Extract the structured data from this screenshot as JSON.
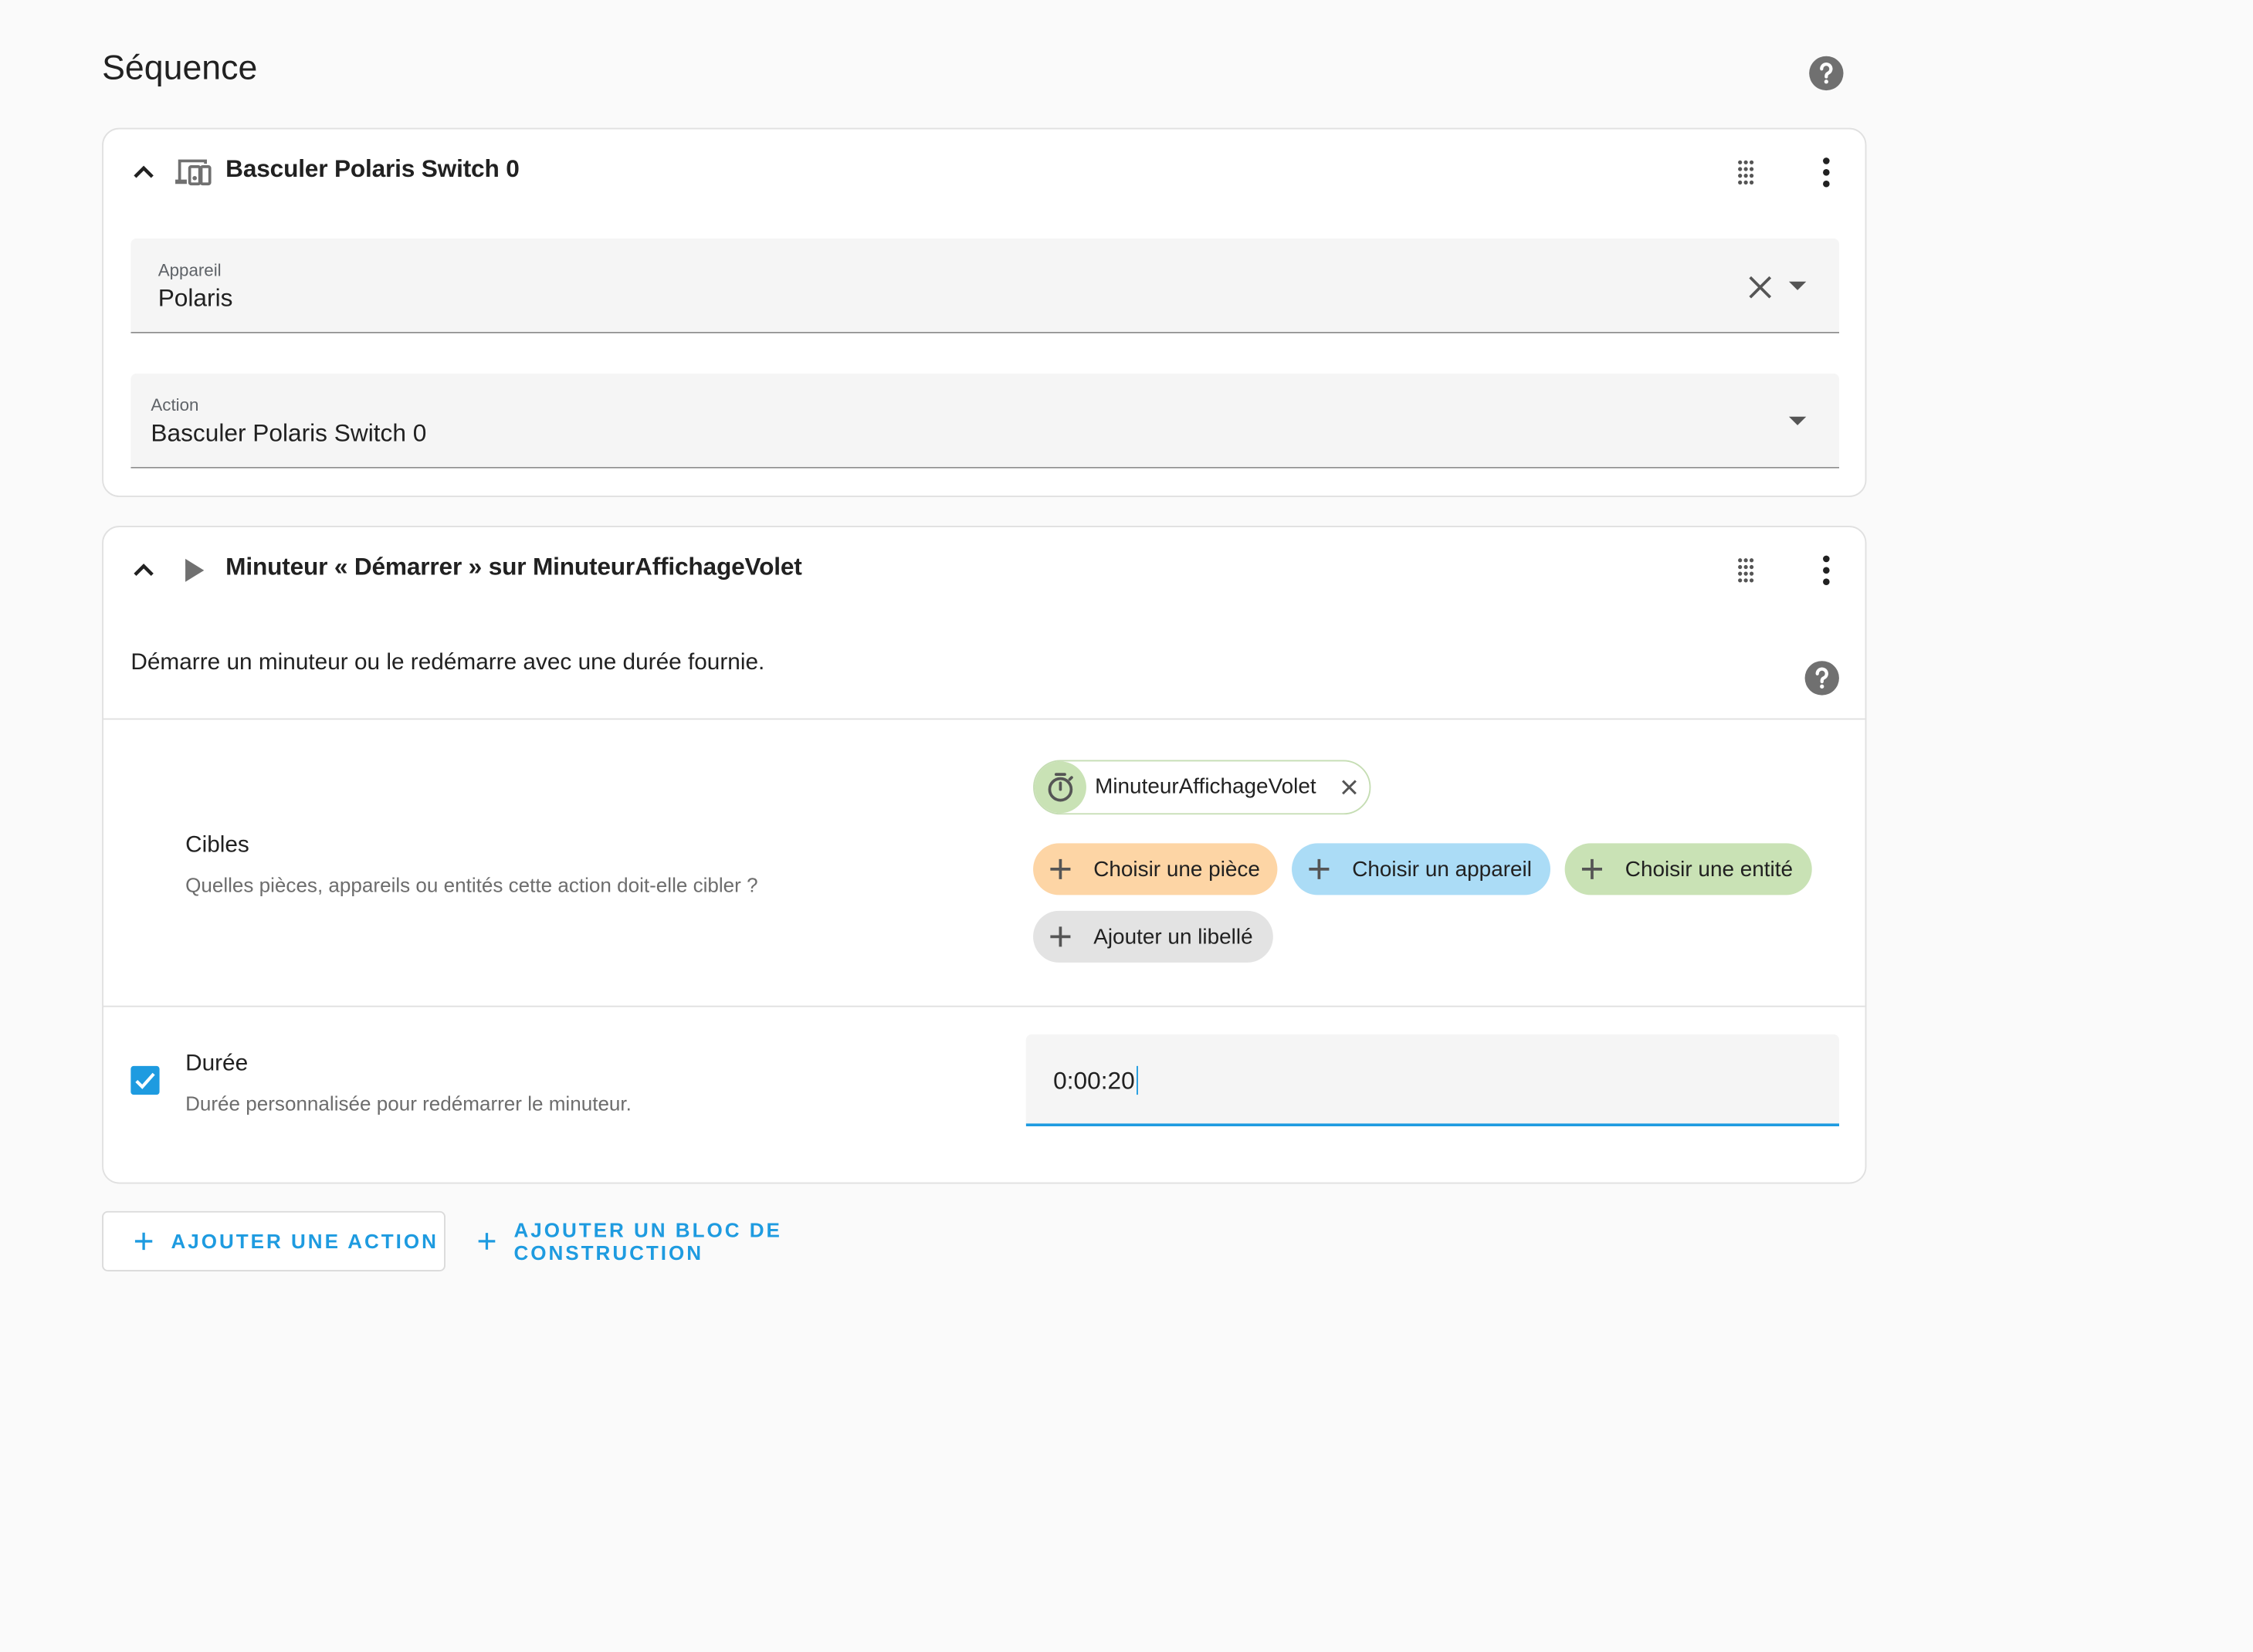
{
  "page": {
    "title": "Séquence",
    "help_icon": "help-circle-icon"
  },
  "colors": {
    "accent": "#1e9be0",
    "chip_room": "#fdd5a5",
    "chip_device": "#abdcf6",
    "chip_entity": "#c9e2b5",
    "chip_label": "#e3e3e3"
  },
  "actions": [
    {
      "title": "Basculer Polaris Switch 0",
      "icon": "devices-icon",
      "fields": {
        "device": {
          "label": "Appareil",
          "value": "Polaris"
        },
        "action": {
          "label": "Action",
          "value": "Basculer Polaris Switch 0"
        }
      }
    },
    {
      "title": "Minuteur « Démarrer » sur MinuteurAffichageVolet",
      "icon": "play-icon",
      "description": "Démarre un minuteur ou le redémarre avec une durée fournie.",
      "targets": {
        "title": "Cibles",
        "subtitle": "Quelles pièces, appareils ou entités cette action doit-elle cibler ?",
        "selected_entity": "MinuteurAffichageVolet",
        "choose_room": "Choisir une pièce",
        "choose_device": "Choisir un appareil",
        "choose_entity": "Choisir une entité",
        "add_label": "Ajouter un libellé"
      },
      "duration": {
        "checked": true,
        "title": "Durée",
        "subtitle": "Durée personnalisée pour redémarrer le minuteur.",
        "value": "0:00:20"
      }
    }
  ],
  "footer": {
    "add_action": "Ajouter une action",
    "add_building_block": "Ajouter un bloc de construction"
  }
}
